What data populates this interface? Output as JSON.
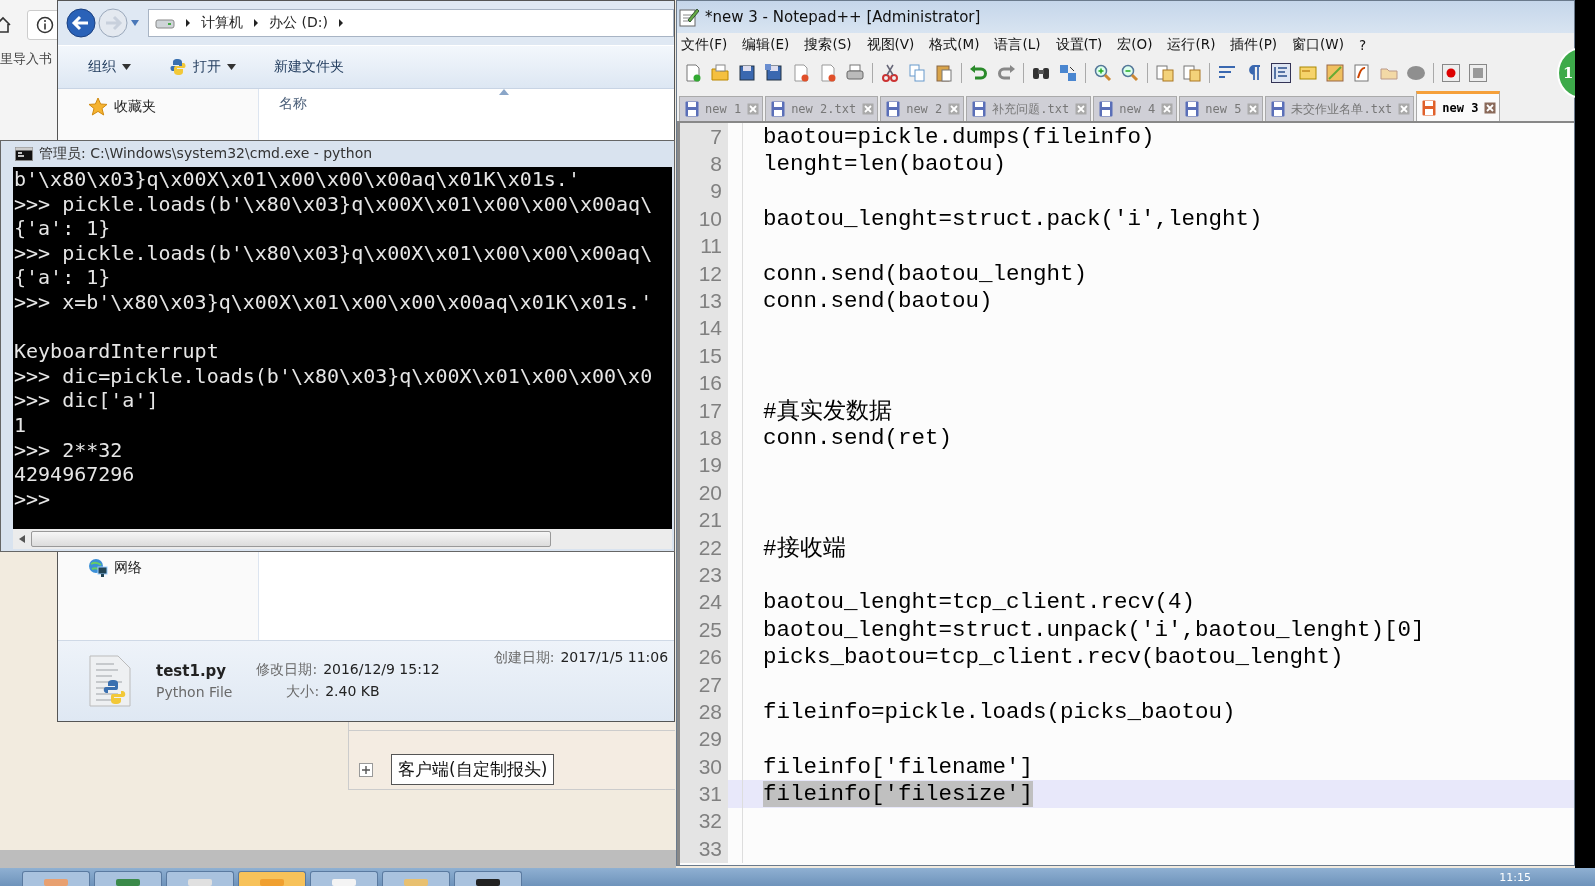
{
  "browser_behind": {
    "text": "里导入书"
  },
  "explorer": {
    "breadcrumb": [
      "计算机",
      "办公 (D:)"
    ],
    "toolbar": [
      {
        "label": "组织",
        "kind": "menu",
        "dropdown": true
      },
      {
        "label": "打开",
        "kind": "python",
        "dropdown": true
      },
      {
        "label": "新建文件夹",
        "kind": "plain",
        "dropdown": false
      }
    ],
    "nav": [
      {
        "label": "收藏夹",
        "kind": "favorites"
      },
      {
        "label": "网络",
        "kind": "network"
      }
    ],
    "column": "名称",
    "details": {
      "name": "test1.py",
      "type": "Python File",
      "modified_label": "修改日期:",
      "modified": "2016/12/9 15:12",
      "size_label": "大小:",
      "size": "2.40 KB",
      "created_label": "创建日期:",
      "created": "2017/1/5 11:06"
    }
  },
  "cmd": {
    "title": "管理员: C:\\Windows\\system32\\cmd.exe - python",
    "lines": [
      {
        "text": "b'\\x80\\x03}q\\x00X\\x01\\x00\\x00\\x00aq\\x01K\\x01s.'"
      },
      {
        "text": ">>> pickle.loads(b'\\x80\\x03}q\\x00X\\x01\\x00\\x00\\x00aq\\"
      },
      {
        "text": "{'a': 1}"
      },
      {
        "text": ">>> pickle.loads(b'\\x80\\x03}q\\x00X\\x01\\x00\\x00\\x00aq\\"
      },
      {
        "text": "{'a': 1}"
      },
      {
        "text": ">>> x=b'\\x80\\x03}q\\x00X\\x01\\x00\\x00\\x00aq\\x01K\\x01s.'"
      },
      {
        "text": "KeyboardInterrupt",
        "blank_before": true
      },
      {
        "text": ">>> dic=pickle.loads(b'\\x80\\x03}q\\x00X\\x01\\x00\\x00\\x0"
      },
      {
        "text": ">>> dic['a']"
      },
      {
        "text": "1"
      },
      {
        "text": ">>> 2**32"
      },
      {
        "text": "4294967296"
      },
      {
        "text": ">>>"
      }
    ]
  },
  "tree": {
    "label": "客户端(自定制报头)",
    "expanded": false
  },
  "notepad": {
    "title": "*new 3 - Notepad++ [Administrator]",
    "menu": [
      "文件(F)",
      "编辑(E)",
      "搜索(S)",
      "视图(V)",
      "格式(M)",
      "语言(L)",
      "设置(T)",
      "宏(O)",
      "运行(R)",
      "插件(P)",
      "窗口(W)",
      "?"
    ],
    "tabs": [
      {
        "label": "new 1",
        "selected": false,
        "modified": false
      },
      {
        "label": "new 2.txt",
        "selected": false,
        "modified": false
      },
      {
        "label": "new 2",
        "selected": false,
        "modified": false
      },
      {
        "label": "补充问题.txt",
        "selected": false,
        "modified": false
      },
      {
        "label": "new 4",
        "selected": false,
        "modified": false
      },
      {
        "label": "new 5",
        "selected": false,
        "modified": false
      },
      {
        "label": "未交作业名单.txt",
        "selected": false,
        "modified": false
      },
      {
        "label": "new 3",
        "selected": true,
        "modified": true
      }
    ],
    "lines": [
      {
        "number": "7",
        "text": "baotou=pickle.dumps(fileinfo)",
        "current": false
      },
      {
        "number": "8",
        "text": "lenght=len(baotou)",
        "current": false
      },
      {
        "number": "9",
        "current": false
      },
      {
        "number": "10",
        "text": "baotou_lenght=struct.pack('i',lenght)",
        "current": false
      },
      {
        "number": "11",
        "current": false
      },
      {
        "number": "12",
        "text": "conn.send(baotou_lenght)",
        "current": false
      },
      {
        "number": "13",
        "text": "conn.send(baotou)",
        "current": false
      },
      {
        "number": "14",
        "current": false
      },
      {
        "number": "15",
        "current": false
      },
      {
        "number": "16",
        "current": false
      },
      {
        "number": "17",
        "text": "#真实发数据",
        "current": false
      },
      {
        "number": "18",
        "text": "conn.send(ret)",
        "current": false
      },
      {
        "number": "19",
        "current": false
      },
      {
        "number": "20",
        "current": false
      },
      {
        "number": "21",
        "current": false
      },
      {
        "number": "22",
        "text": "#接收端",
        "current": false
      },
      {
        "number": "23",
        "current": false
      },
      {
        "number": "24",
        "text": "baotou_lenght=tcp_client.recv(4)",
        "current": false
      },
      {
        "number": "25",
        "text": "baotou_lenght=struct.unpack('i',baotou_lenght)[0]",
        "current": false
      },
      {
        "number": "26",
        "text": "picks_baotou=tcp_client.recv(baotou_lenght)",
        "current": false
      },
      {
        "number": "27",
        "current": false
      },
      {
        "number": "28",
        "text": "fileinfo=pickle.loads(picks_baotou)",
        "current": false
      },
      {
        "number": "29",
        "current": false
      },
      {
        "number": "30",
        "text": "fileinfo['filename']",
        "current": false
      },
      {
        "number": "31",
        "text": "fileinfo['filesize']",
        "current": true
      },
      {
        "number": "32",
        "current": false
      },
      {
        "number": "33",
        "current": false
      }
    ]
  },
  "badge": "1",
  "clock": "11:15"
}
